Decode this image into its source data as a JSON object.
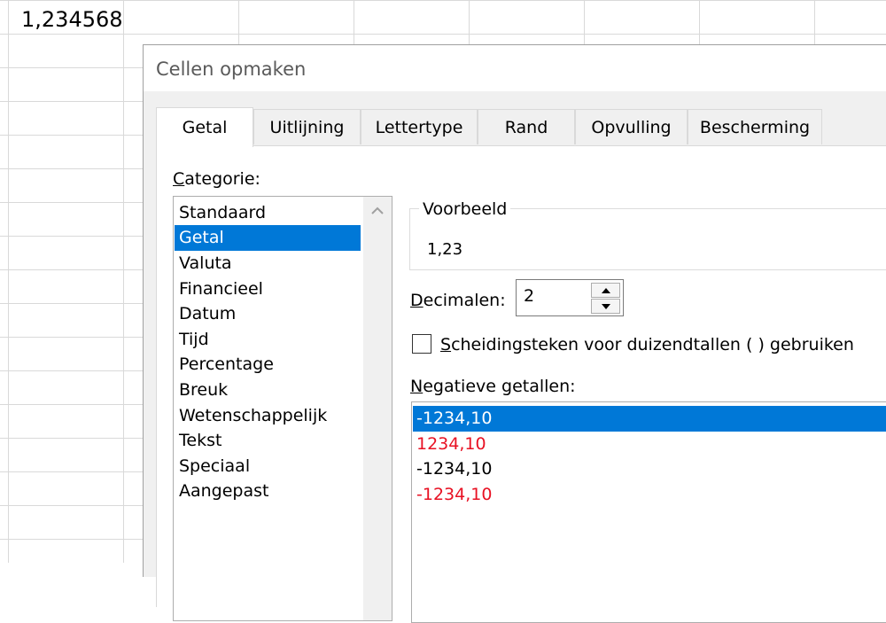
{
  "sheet": {
    "cell_value": "1,234568"
  },
  "dialog": {
    "title": "Cellen opmaken",
    "tabs": [
      {
        "label": "Getal",
        "active": true
      },
      {
        "label": "Uitlijning"
      },
      {
        "label": "Lettertype"
      },
      {
        "label": "Rand"
      },
      {
        "label": "Opvulling"
      },
      {
        "label": "Bescherming"
      }
    ],
    "category_label_first": "C",
    "category_label_rest": "ategorie:",
    "categories": [
      "Standaard",
      "Getal",
      "Valuta",
      "Financieel",
      "Datum",
      "Tijd",
      "Percentage",
      "Breuk",
      "Wetenschappelijk",
      "Tekst",
      "Speciaal",
      "Aangepast"
    ],
    "selected_category": "Getal",
    "preview": {
      "legend": "Voorbeeld",
      "value": "1,23"
    },
    "decimals": {
      "label_first": "D",
      "label_rest": "ecimalen:",
      "value": "2"
    },
    "thousands": {
      "label_first": "S",
      "label_rest": "cheidingsteken voor duizendtallen ( ) gebruiken",
      "checked": false
    },
    "negative": {
      "label_first": "N",
      "label_rest": "egatieve getallen:",
      "items": [
        "-1234,10",
        "1234,10",
        "-1234,10",
        "-1234,10"
      ]
    },
    "colors": {
      "accent": "#0078d7",
      "negative_red": "#e81123"
    }
  }
}
